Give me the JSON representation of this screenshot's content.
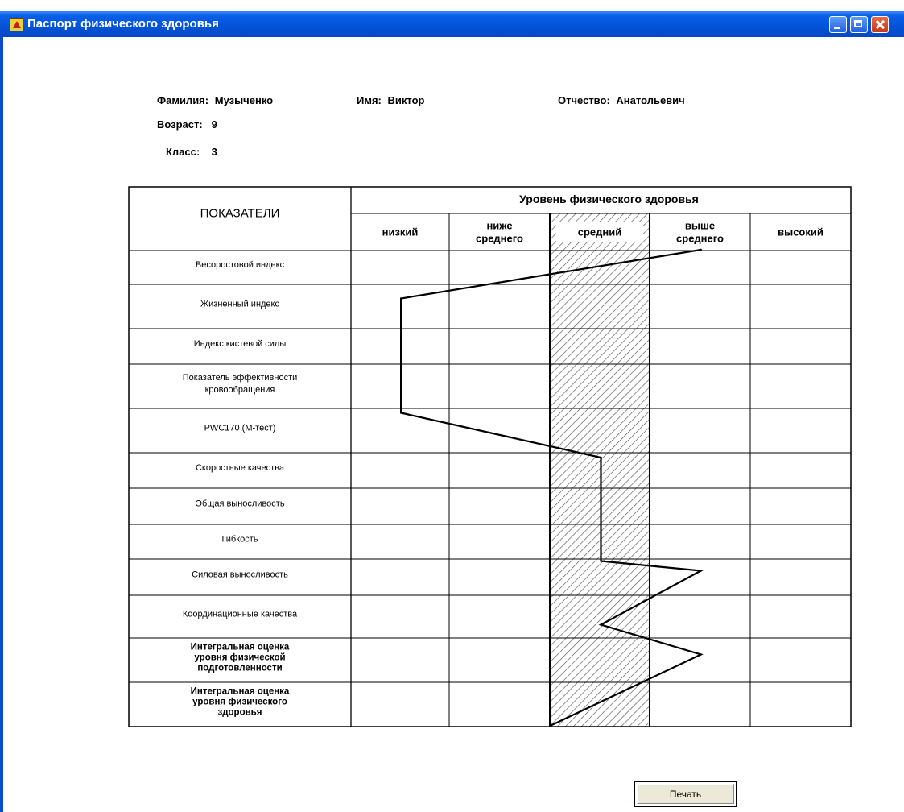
{
  "window": {
    "title": "Паспорт физического здоровья"
  },
  "student": {
    "surname_label": "Фамилия:",
    "surname": "Музыченко",
    "name_label": "Имя:",
    "name": "Виктор",
    "patronymic_label": "Отчество:",
    "patronymic": "Анатольевич",
    "age_label": "Возраст:",
    "age": "9",
    "class_label": "Класс:",
    "class": "3"
  },
  "table": {
    "indicators_header": "ПОКАЗАТЕЛИ",
    "level_header": "Уровень физического здоровья",
    "levels": [
      [
        "низкий"
      ],
      [
        "ниже",
        "среднего"
      ],
      [
        "средний"
      ],
      [
        "выше",
        "среднего"
      ],
      [
        "высокий"
      ]
    ],
    "highlighted_level": "средний",
    "rows": [
      {
        "label": [
          "Весоростовой индекс"
        ],
        "bold": false
      },
      {
        "label": [
          "Жизненный индекс"
        ],
        "bold": false
      },
      {
        "label": [
          "Индекс кистевой силы"
        ],
        "bold": false
      },
      {
        "label": [
          "Показатель эффективности",
          "кровообращения"
        ],
        "bold": false
      },
      {
        "label": [
          "PWC170 (М-тест)"
        ],
        "bold": false
      },
      {
        "label": [
          "Скоростные качества"
        ],
        "bold": false
      },
      {
        "label": [
          "Общая выносливость"
        ],
        "bold": false
      },
      {
        "label": [
          "Гибкость"
        ],
        "bold": false
      },
      {
        "label": [
          "Силовая выносливость"
        ],
        "bold": false
      },
      {
        "label": [
          "Координационные качества"
        ],
        "bold": false
      },
      {
        "label": [
          "Интегральная оценка",
          "уровня физической",
          "подготовленности"
        ],
        "bold": true
      },
      {
        "label": [
          "Интегральная оценка",
          "уровня физического",
          "здоровья"
        ],
        "bold": true
      }
    ],
    "profile_levels": [
      4,
      1,
      1,
      1,
      1,
      3,
      3,
      3,
      4,
      3,
      4,
      2.5
    ]
  },
  "buttons": {
    "print_label": "Печать"
  }
}
